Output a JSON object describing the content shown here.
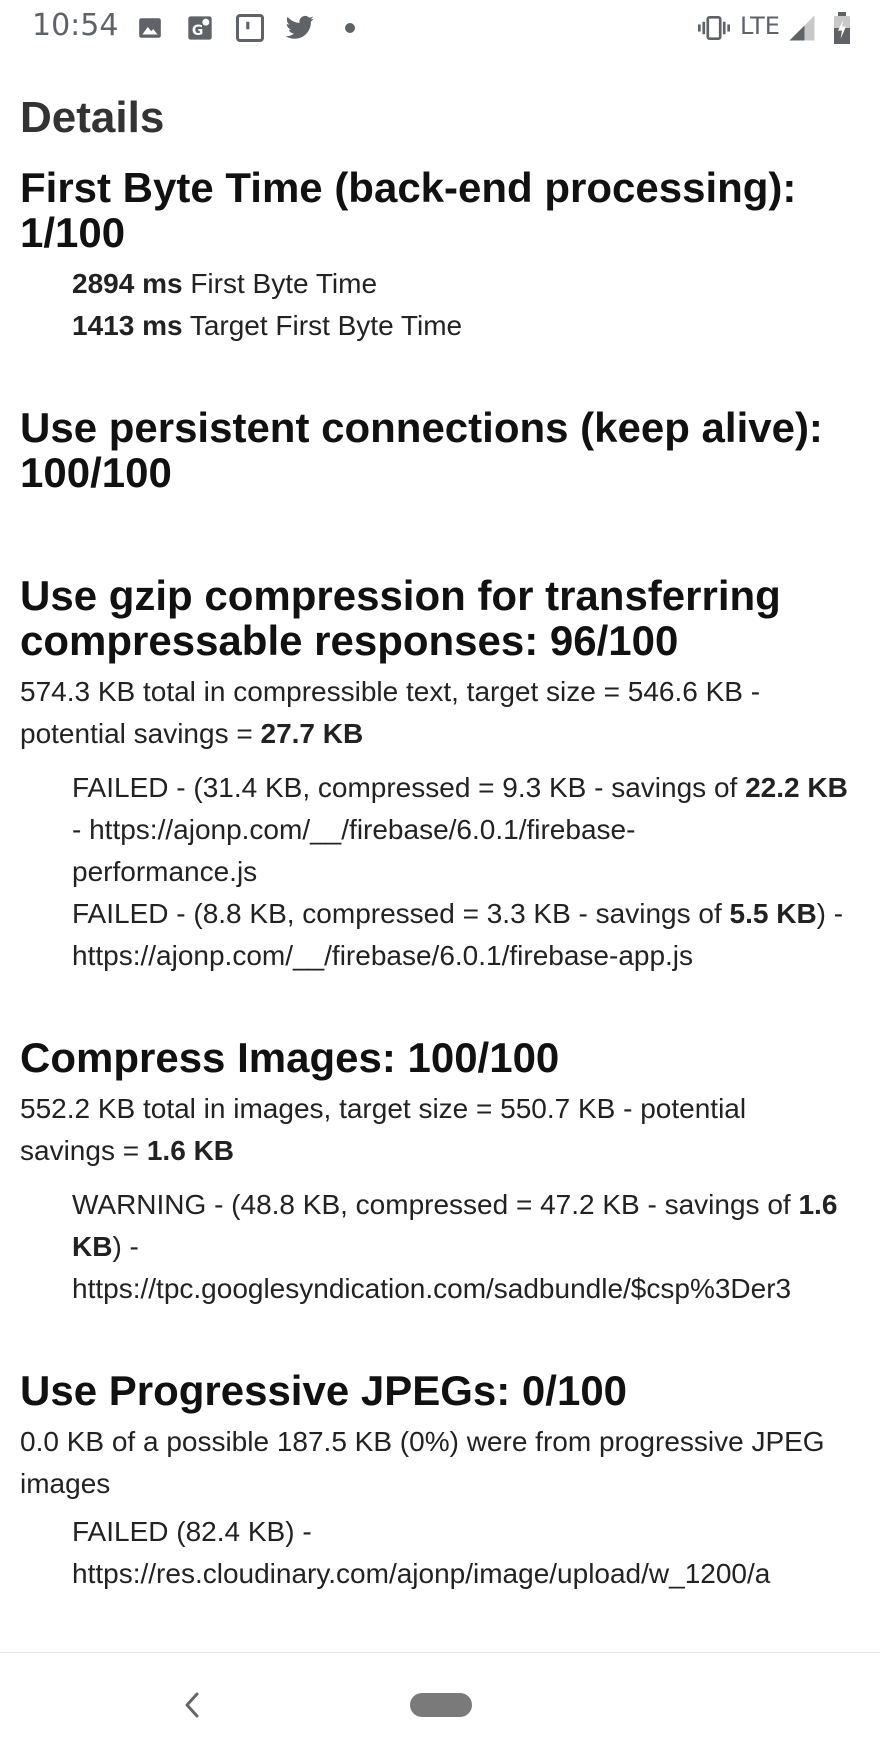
{
  "status_bar": {
    "time": "10:54",
    "network": "LTE",
    "icons": [
      "image-icon",
      "map-icon",
      "app-icon",
      "twitter-icon",
      "dot-icon",
      "vibrate-icon",
      "signal-icon",
      "battery-icon"
    ]
  },
  "page": {
    "title": "Details"
  },
  "sections": {
    "first_byte": {
      "title_line1": "First Byte Time (back-end processing):",
      "title_line2": "1/100",
      "metric1_value": "2894 ms",
      "metric1_label": " First Byte Time",
      "metric2_value": "1413 ms",
      "metric2_label": " Target First Byte Time"
    },
    "keep_alive": {
      "title_line1": "Use persistent connections (keep alive):",
      "title_line2": "100/100"
    },
    "gzip": {
      "title_line1": "Use gzip compression for transferring",
      "title_line2": "compressable responses: 96/100",
      "summary_line1": "574.3 KB total in compressible text, target size = 546.6 KB -",
      "summary_line2_pre": "potential savings = ",
      "summary_line2_bold": "27.7 KB",
      "item1_line1_pre": "FAILED - (31.4 KB, compressed = 9.3 KB - savings of ",
      "item1_line1_bold": "22.2 KB",
      "item1_line2": "- https://ajonp.com/__/firebase/6.0.1/firebase-",
      "item1_line3": "performance.js",
      "item2_line1_pre": "FAILED - (8.8 KB, compressed = 3.3 KB - savings of ",
      "item2_line1_bold": "5.5 KB",
      "item2_line1_post": ") -",
      "item2_line2": "https://ajonp.com/__/firebase/6.0.1/firebase-app.js"
    },
    "images": {
      "title": "Compress Images: 100/100",
      "summary_line1": "552.2 KB total in images, target size = 550.7 KB - potential",
      "summary_line2_pre": "savings = ",
      "summary_line2_bold": "1.6 KB",
      "item1_line1_pre": "WARNING - (48.8 KB, compressed = 47.2 KB - savings of ",
      "item1_line1_bold": "1.6",
      "item1_line2_bold": "KB",
      "item1_line2_post": ") -",
      "item1_line3": "https://tpc.googlesyndication.com/sadbundle/$csp%3Der3"
    },
    "jpeg": {
      "title": "Use Progressive JPEGs: 0/100",
      "summary_line1": "0.0 KB of a possible 187.5 KB (0%) were from progressive JPEG",
      "summary_line2": "images",
      "item1_line1": "FAILED (82.4 KB) -",
      "item1_line2": "https://res.cloudinary.com/ajonp/image/upload/w_1200/a"
    }
  },
  "nav": {
    "back_icon": "back-icon",
    "home_icon": "home-pill-icon"
  }
}
